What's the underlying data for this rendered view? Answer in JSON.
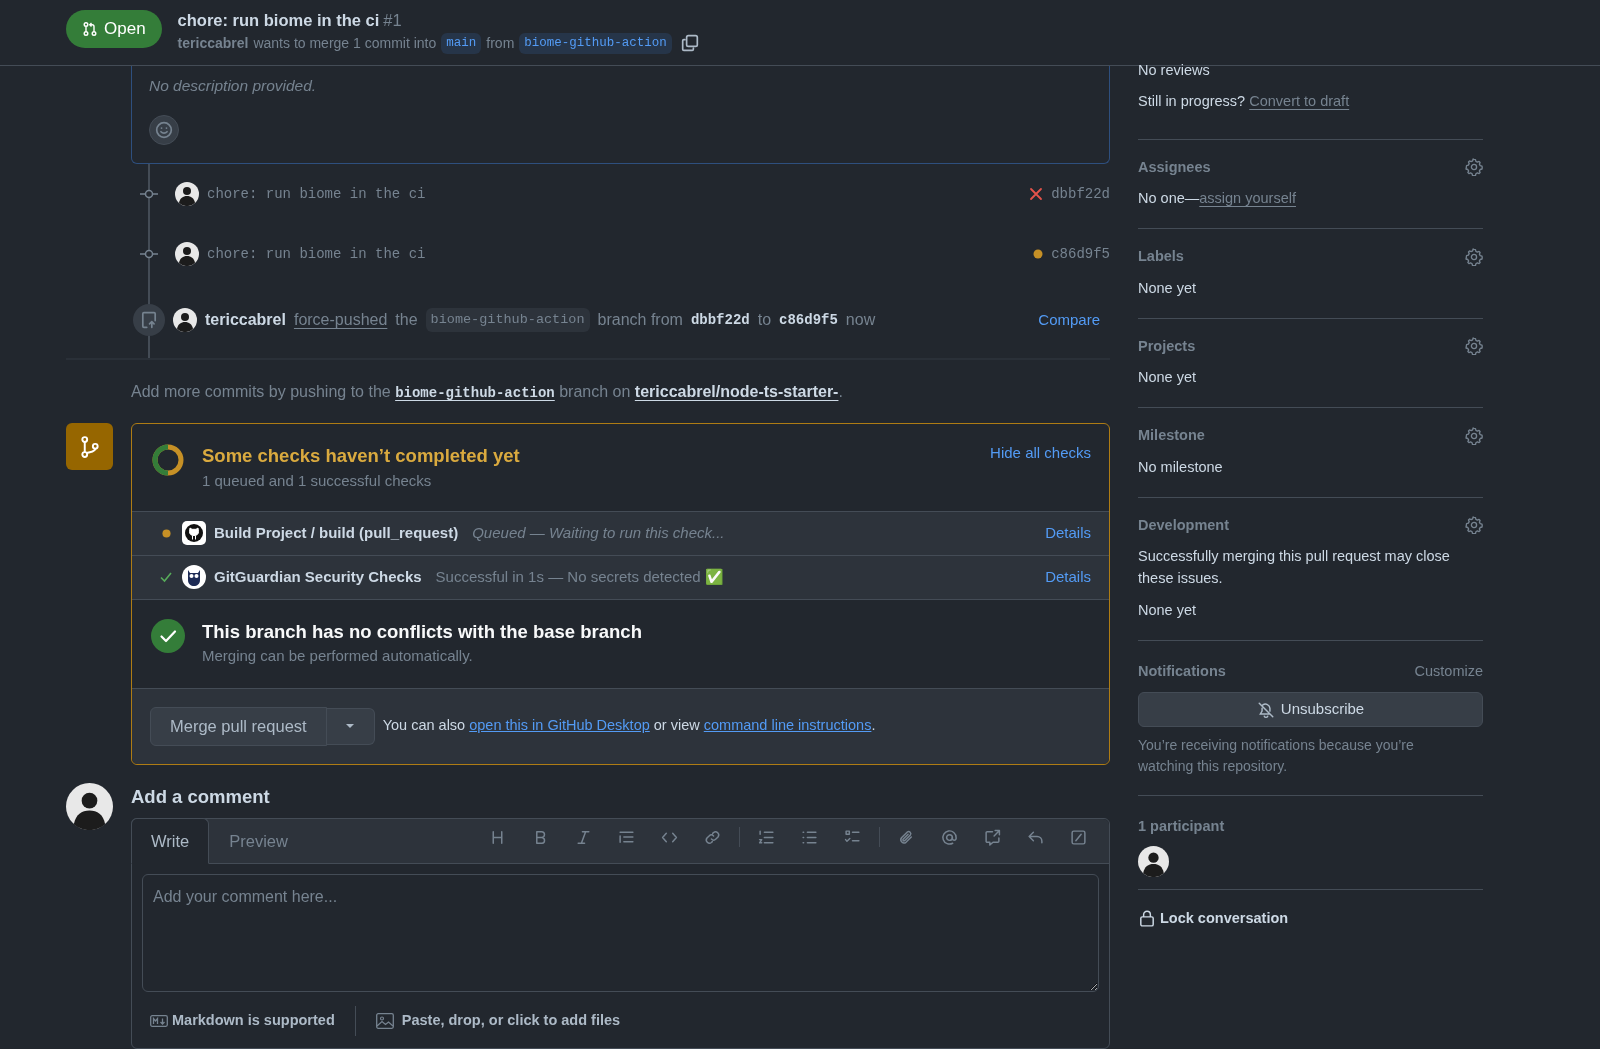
{
  "header": {
    "state": "Open",
    "title": "chore: run biome in the ci",
    "number": "#1",
    "author": "tericcabrel",
    "merge_text": "wants to merge 1 commit into",
    "base": "main",
    "from_text": "from",
    "head": "biome-github-action"
  },
  "description": {
    "text": "No description provided."
  },
  "commits": [
    {
      "message": "chore: run biome in the ci",
      "kind": "failure",
      "sha": "dbbf22d"
    },
    {
      "message": "chore: run biome in the ci",
      "kind": "pending",
      "sha": "c86d9f5"
    }
  ],
  "force_push": {
    "actor": "tericcabrel",
    "action": "force-pushed",
    "the": "the",
    "branch": "biome-github-action",
    "from_text": "branch from",
    "from_sha": "dbbf22d",
    "to_text": "to",
    "to_sha": "c86d9f5",
    "when": "now",
    "compare": "Compare"
  },
  "push_hint": [
    {
      "text": "Add more commits by pushing to the "
    },
    {
      "link": "biome-github-action",
      "mono": true
    },
    {
      "text": " branch on "
    },
    {
      "link": "tericcabrel/node-ts-starter-"
    },
    {
      "text": "."
    }
  ],
  "checks": {
    "title": "Some checks haven’t completed yet",
    "subtitle": "1 queued and 1 successful checks",
    "toggle": "Hide all checks",
    "level": 0.5,
    "items": [
      {
        "kind": "queued",
        "name": "Build Project / build (pull_request)",
        "description": "Queued — Waiting to run this check...",
        "details": "Details"
      },
      {
        "kind": "success",
        "name": "GitGuardian Security Checks",
        "description": "Successful in 1s — No secrets detected ✅",
        "details": "Details"
      }
    ]
  },
  "merge_status": {
    "title": "This branch has no conflicts with the base branch",
    "subtitle": "Merging can be performed automatically."
  },
  "merge": {
    "button": "Merge pull request",
    "hint": [
      {
        "text": "You can also "
      },
      {
        "link": "open this in GitHub Desktop"
      },
      {
        "text": " or view "
      },
      {
        "link": "command line instructions"
      },
      {
        "text": "."
      }
    ]
  },
  "comment": {
    "heading": "Add a comment",
    "tabs": [
      {
        "label": "Write",
        "selected": true
      },
      {
        "label": "Preview",
        "selected": false
      }
    ],
    "placeholder": "Add your comment here...",
    "markdown": "Markdown is supported",
    "files": "Paste, drop, or click to add files"
  },
  "sidebar": {
    "reviews": {
      "value": "No reviews",
      "prompt": "Still in progress?",
      "link": "Convert to draft"
    },
    "sections": [
      {
        "title": "Assignees",
        "body": [
          {
            "text": "No one—",
            "link": "assign yourself"
          }
        ]
      },
      {
        "title": "Labels",
        "body": [
          {
            "text": "None yet"
          }
        ]
      },
      {
        "title": "Projects",
        "body": [
          {
            "text": "None yet"
          }
        ]
      },
      {
        "title": "Milestone",
        "body": [
          {
            "text": "No milestone"
          }
        ]
      },
      {
        "title": "Development",
        "body": [
          {
            "text": "Successfully merging this pull request may close these issues."
          },
          {
            "text": "None yet"
          }
        ]
      }
    ],
    "notifications": {
      "title": "Notifications",
      "customize": "Customize",
      "button": "Unsubscribe",
      "note": "You’re receiving notifications because you’re watching this repository."
    },
    "participants": {
      "title": "1 participant"
    },
    "lock": "Lock conversation"
  }
}
